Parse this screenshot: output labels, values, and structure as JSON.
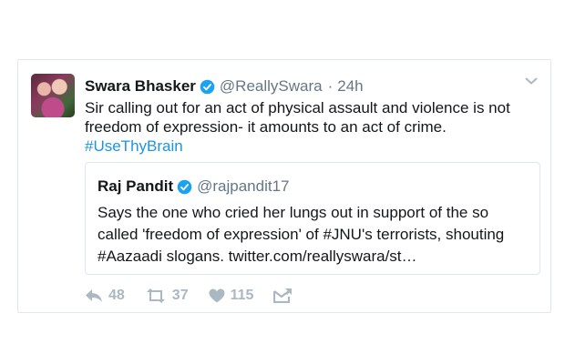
{
  "tweet": {
    "author_name": "Swara Bhasker",
    "author_handle": "@ReallySwara",
    "separator": "·",
    "time": "24h",
    "text_line": "Sir calling out for an act of physical assault and violence is not freedom of expression- it amounts to an act of crime.",
    "hashtag": "#UseThyBrain"
  },
  "quoted": {
    "author_name": "Raj Pandit",
    "author_handle": "@rajpandit17",
    "text": "Says the one who cried her lungs out in support of the so called 'freedom of expression' of #JNU's terrorists, shouting #Aazaadi slogans. twitter.com/reallyswara/st…"
  },
  "actions": {
    "reply_count": "48",
    "retweet_count": "37",
    "like_count": "115"
  },
  "colors": {
    "link": "#1b95e0",
    "muted": "#657786",
    "action_gray": "#aab8c2",
    "verified": "#1da1f2",
    "border": "#e1e8ed"
  },
  "icons": [
    "verified-badge-icon",
    "chevron-down-icon",
    "reply-icon",
    "retweet-icon",
    "like-icon",
    "direct-message-icon"
  ]
}
